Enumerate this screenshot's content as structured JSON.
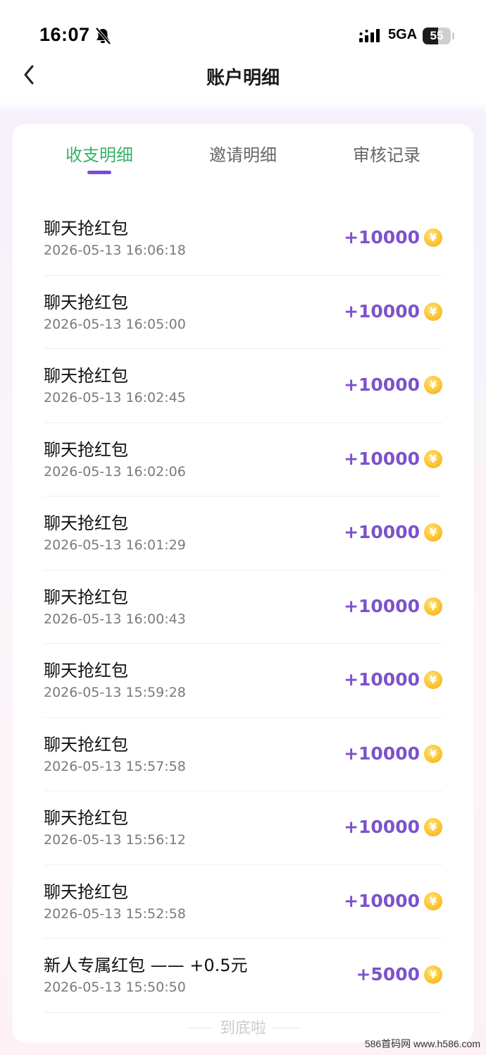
{
  "status_bar": {
    "time": "16:07",
    "network": "5GA",
    "battery": "55",
    "battery_level": 0.55
  },
  "nav": {
    "title": "账户明细"
  },
  "tabs": [
    {
      "label": "收支明细",
      "active": true
    },
    {
      "label": "邀请明细",
      "active": false
    },
    {
      "label": "审核记录",
      "active": false
    }
  ],
  "colors": {
    "active_tab": "#36b16b",
    "indicator": "#7b4ad8",
    "amount": "#7c52cc",
    "coin": "#fbc531"
  },
  "coin_symbol": "¥",
  "records": [
    {
      "title": "聊天抢红包",
      "time": "2026-05-13 16:06:18",
      "amount": "+10000"
    },
    {
      "title": "聊天抢红包",
      "time": "2026-05-13 16:05:00",
      "amount": "+10000"
    },
    {
      "title": "聊天抢红包",
      "time": "2026-05-13 16:02:45",
      "amount": "+10000"
    },
    {
      "title": "聊天抢红包",
      "time": "2026-05-13 16:02:06",
      "amount": "+10000"
    },
    {
      "title": "聊天抢红包",
      "time": "2026-05-13 16:01:29",
      "amount": "+10000"
    },
    {
      "title": "聊天抢红包",
      "time": "2026-05-13 16:00:43",
      "amount": "+10000"
    },
    {
      "title": "聊天抢红包",
      "time": "2026-05-13 15:59:28",
      "amount": "+10000"
    },
    {
      "title": "聊天抢红包",
      "time": "2026-05-13 15:57:58",
      "amount": "+10000"
    },
    {
      "title": "聊天抢红包",
      "time": "2026-05-13 15:56:12",
      "amount": "+10000"
    },
    {
      "title": "聊天抢红包",
      "time": "2026-05-13 15:52:58",
      "amount": "+10000"
    },
    {
      "title": "新人专属红包 —— +0.5元",
      "time": "2026-05-13 15:50:50",
      "amount": "+5000"
    }
  ],
  "end_hint": "到底啦",
  "watermark": "586首码网 www.h586.com"
}
